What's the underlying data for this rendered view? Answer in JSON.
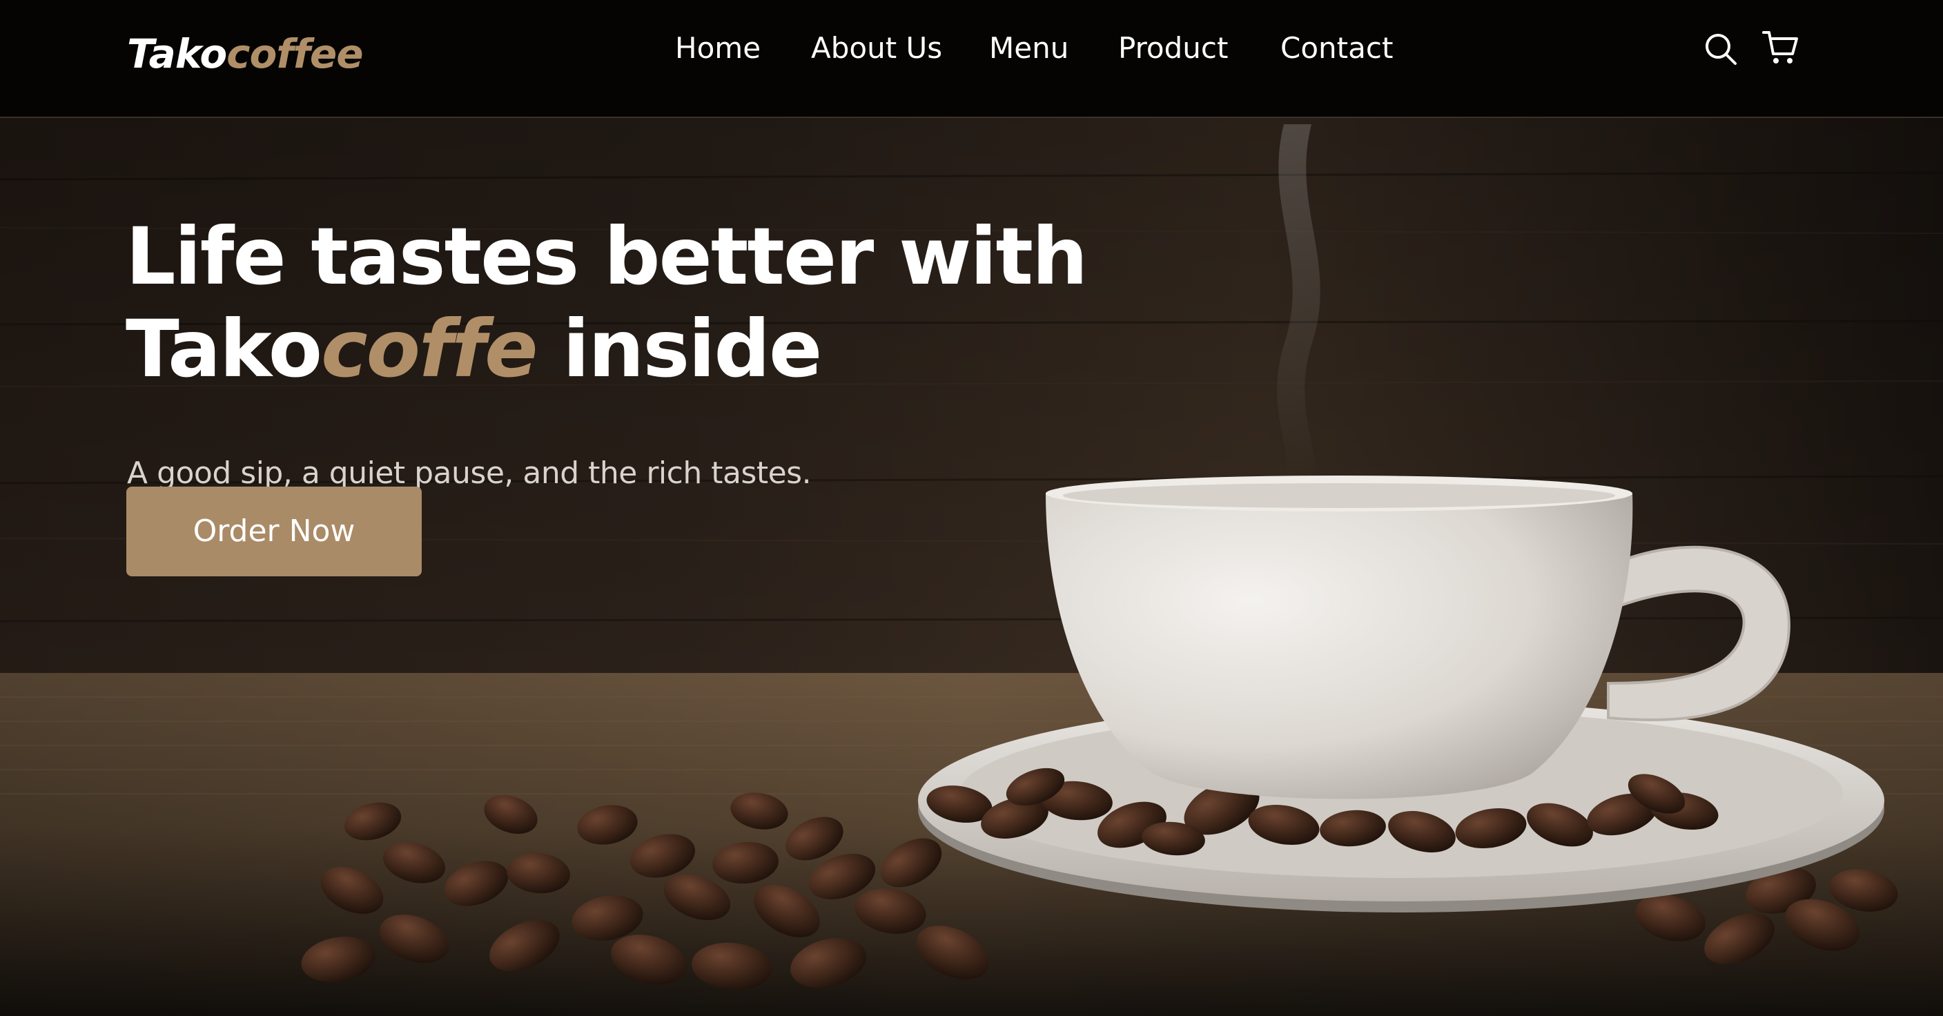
{
  "header": {
    "logo": {
      "part1": "Tako",
      "part2": "coffee"
    },
    "nav": [
      {
        "label": "Home"
      },
      {
        "label": "About Us"
      },
      {
        "label": "Menu"
      },
      {
        "label": "Product"
      },
      {
        "label": "Contact"
      }
    ],
    "icons": [
      "search-icon",
      "cart-icon"
    ]
  },
  "hero": {
    "headline_line1": "Life tastes better with",
    "headline_line2_a": "Tako",
    "headline_line2_accent": "coffe",
    "headline_line2_b": " inside",
    "subtitle": "A good sip, a quiet pause, and the rich tastes.",
    "cta_label": "Order Now",
    "image": "coffee cup on saucer with coffee beans on burlap"
  },
  "colors": {
    "accent": "#b08f68",
    "button": "#aa8b67",
    "header_bg": "#050403",
    "text": "#ffffff"
  }
}
